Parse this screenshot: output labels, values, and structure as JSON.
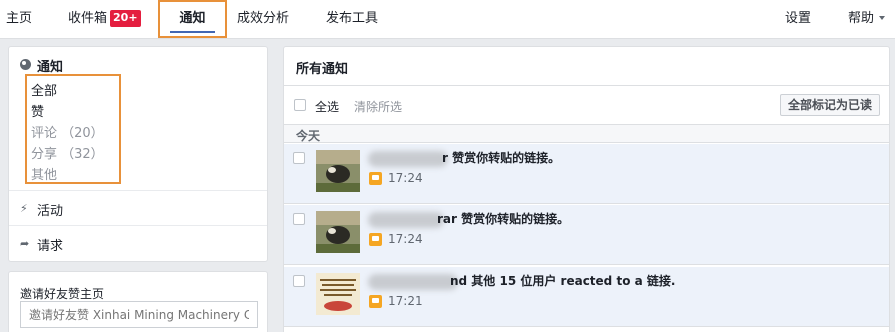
{
  "nav": {
    "home": "主页",
    "inbox": "收件箱",
    "inbox_badge": "20+",
    "notifications": "通知",
    "insights": "成效分析",
    "publishing_tools": "发布工具",
    "settings": "设置",
    "help": "帮助"
  },
  "sidebar": {
    "title": "通知",
    "filters": [
      {
        "label": "全部",
        "active": true
      },
      {
        "label": "赞",
        "active": true
      },
      {
        "label": "评论 （20）",
        "active": false
      },
      {
        "label": "分享 （32）",
        "active": false
      },
      {
        "label": "其他",
        "active": false
      }
    ],
    "activity": "活动",
    "requests": "请求",
    "invite_title": "邀请好友赞主页",
    "invite_placeholder": "邀请好友赞 Xinhai Mining Machinery C..."
  },
  "main": {
    "title": "所有通知",
    "select_all": "全选",
    "clear_selection": "清除所选",
    "mark_all_read": "全部标记为已读",
    "date_group": "今天",
    "notifications": [
      {
        "text": "r 赞赏你转贴的链接。",
        "time": "17:24",
        "thumb": "bear"
      },
      {
        "text": "rar 赞赏你转贴的链接。",
        "time": "17:24",
        "thumb": "bear"
      },
      {
        "text": "nd 其他 15 位用户 reacted to a 链接.",
        "time": "17:21",
        "thumb": "arabic"
      }
    ]
  },
  "colors": {
    "highlight_border": "#e8913a",
    "badge": "#e41e3f",
    "accent": "#4267b2",
    "unread_bg": "#edf2fa"
  }
}
